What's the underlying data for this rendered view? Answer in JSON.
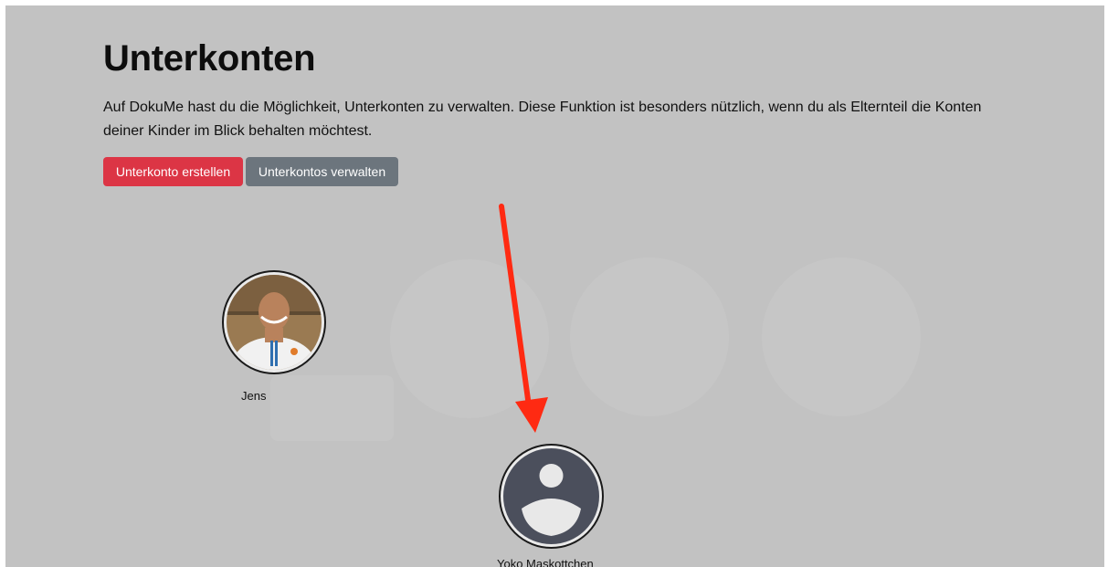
{
  "page": {
    "title": "Unterkonten",
    "intro": "Auf DokuMe hast du die Möglichkeit, Unterkonten zu verwalten. Diese Funktion ist besonders nützlich, wenn du als Elternteil die Konten deiner Kinder im Blick behalten möchtest."
  },
  "buttons": {
    "create_label": "Unterkonto erstellen",
    "manage_label": "Unterkontos verwalten"
  },
  "accounts": [
    {
      "name": "Jens",
      "avatar": "photo"
    },
    {
      "name": "Yoko Maskottchen",
      "avatar": "default-user-icon"
    }
  ],
  "annotation": {
    "arrow_color": "#ff2a12"
  },
  "colors": {
    "overlay": "#c2c2c2",
    "create_button": "#dc3545",
    "manage_button": "#6c757d",
    "default_avatar": "#4b4f5c"
  }
}
